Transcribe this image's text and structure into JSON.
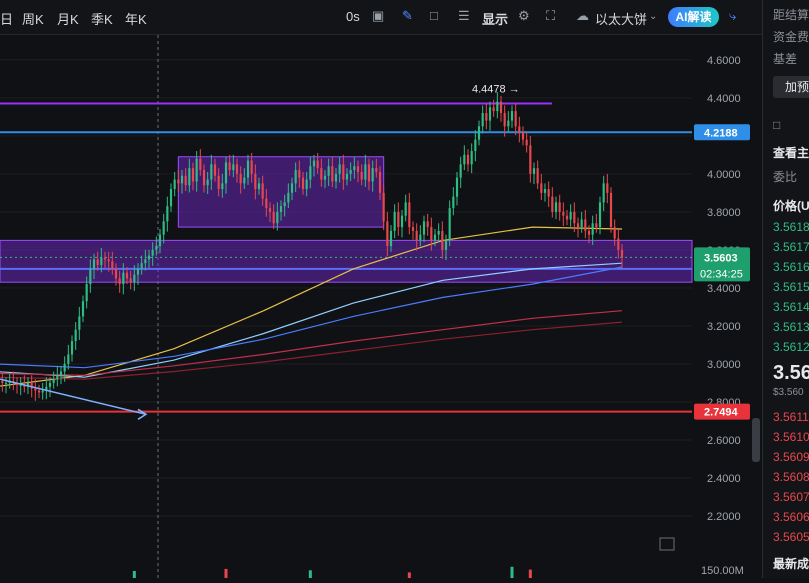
{
  "toolbar": {
    "items": [
      "日",
      "周K",
      "月K",
      "季K",
      "年K"
    ],
    "interval": "0s",
    "display": "显示",
    "symbol": "以太大饼",
    "ai_button": "AI解读"
  },
  "right_panel": {
    "lines": [
      "距结算",
      "资金费",
      "基差",
      "加预",
      "查看主",
      "委比",
      "价格(U"
    ],
    "asks": [
      "3.5618",
      "3.5617",
      "3.5616",
      "3.5615",
      "3.5614",
      "3.5613",
      "3.5612"
    ],
    "last_price": "3.56",
    "last_price_sub": "$3.560",
    "bids": [
      "3.5611",
      "3.5610",
      "3.5609",
      "3.5608",
      "3.5607",
      "3.5606",
      "3.5605"
    ],
    "footer": "最新成"
  },
  "chart_data": {
    "type": "candlestick",
    "title": "",
    "y_ticks": [
      4.6,
      4.4,
      4.2,
      4.0,
      3.8,
      3.6,
      3.4,
      3.2,
      3.0,
      2.8,
      2.6,
      2.4,
      2.2
    ],
    "ylim": [
      2.1,
      4.72
    ],
    "price_labels": {
      "resistance": "4.2188",
      "current": "3.5603",
      "countdown": "02:34:25",
      "support": "2.7494",
      "high_marker": "4.4478"
    },
    "volume_label": "150.00M",
    "horizontal_lines": [
      {
        "value": 4.37,
        "color": "#9b30ff"
      },
      {
        "value": 4.2188,
        "color": "#2f8fe8"
      },
      {
        "value": 3.5,
        "color": "#5b6cff"
      },
      {
        "value": 2.7494,
        "color": "#e8333a"
      }
    ],
    "zones": [
      {
        "from": 3.43,
        "to": 3.65,
        "color": "#7a2bd6"
      },
      {
        "from_bar": 50,
        "to_bar": 106,
        "low": 3.72,
        "high": 4.09,
        "color": "#7a2bd6"
      }
    ],
    "closes": [
      2.92,
      2.91,
      2.9,
      2.9,
      2.91,
      2.9,
      2.89,
      2.89,
      2.88,
      2.9,
      2.87,
      2.86,
      2.85,
      2.86,
      2.88,
      2.9,
      2.92,
      2.94,
      2.96,
      3.0,
      3.05,
      3.12,
      3.18,
      3.25,
      3.33,
      3.42,
      3.5,
      3.55,
      3.52,
      3.56,
      3.55,
      3.54,
      3.5,
      3.45,
      3.42,
      3.48,
      3.45,
      3.43,
      3.47,
      3.5,
      3.53,
      3.55,
      3.57,
      3.6,
      3.62,
      3.68,
      3.75,
      3.83,
      3.92,
      3.97,
      3.95,
      3.99,
      3.94,
      4.03,
      3.96,
      4.08,
      4.02,
      3.94,
      3.97,
      4.05,
      3.99,
      3.92,
      3.95,
      4.06,
      4.02,
      4.05,
      4.0,
      3.95,
      3.98,
      4.07,
      4.0,
      3.92,
      3.95,
      3.87,
      3.82,
      3.8,
      3.74,
      3.8,
      3.83,
      3.85,
      3.9,
      3.95,
      4.02,
      3.98,
      3.92,
      3.97,
      4.04,
      4.07,
      4.03,
      3.97,
      3.99,
      4.04,
      3.96,
      4.0,
      4.05,
      3.97,
      4.0,
      4.02,
      4.04,
      4.01,
      3.97,
      4.05,
      3.96,
      4.03,
      4.01,
      3.9,
      3.75,
      3.62,
      3.7,
      3.8,
      3.72,
      3.78,
      3.85,
      3.72,
      3.7,
      3.65,
      3.68,
      3.75,
      3.72,
      3.65,
      3.68,
      3.7,
      3.6,
      3.65,
      3.82,
      3.88,
      3.98,
      4.05,
      4.1,
      4.05,
      4.12,
      4.18,
      4.25,
      4.32,
      4.28,
      4.35,
      4.33,
      4.38,
      4.32,
      4.25,
      4.28,
      4.33,
      4.25,
      4.22,
      4.18,
      4.15,
      4.0,
      4.03,
      3.95,
      3.9,
      3.92,
      3.88,
      3.8,
      3.85,
      3.8,
      3.78,
      3.76,
      3.8,
      3.74,
      3.72,
      3.76,
      3.7,
      3.68,
      3.74,
      3.72,
      3.85,
      3.95,
      3.9,
      3.72,
      3.66,
      3.6,
      3.56
    ],
    "moving_averages": [
      {
        "color": "#e6c14a",
        "values": [
          2.88,
          2.94,
          3.08,
          3.28,
          3.5,
          3.65,
          3.72,
          3.71
        ]
      },
      {
        "color": "#8fd0ff",
        "values": [
          2.96,
          2.93,
          3.02,
          3.16,
          3.32,
          3.44,
          3.5,
          3.53
        ]
      },
      {
        "color": "#4b7bff",
        "values": [
          3.0,
          2.98,
          3.04,
          3.13,
          3.25,
          3.35,
          3.42,
          3.51
        ]
      },
      {
        "color": "#c0304a",
        "values": [
          2.95,
          2.94,
          2.99,
          3.05,
          3.12,
          3.18,
          3.24,
          3.28
        ]
      },
      {
        "color": "#8a2030",
        "values": [
          2.93,
          2.92,
          2.96,
          3.01,
          3.07,
          3.13,
          3.18,
          3.22
        ]
      }
    ],
    "volume_bars": [
      {
        "bar": 38,
        "v": 0.5
      },
      {
        "bar": 63,
        "v": 0.65
      },
      {
        "bar": 86,
        "v": 0.55
      },
      {
        "bar": 113,
        "v": 0.4
      },
      {
        "bar": 141,
        "v": 0.8
      },
      {
        "bar": 146,
        "v": 0.6
      }
    ]
  }
}
